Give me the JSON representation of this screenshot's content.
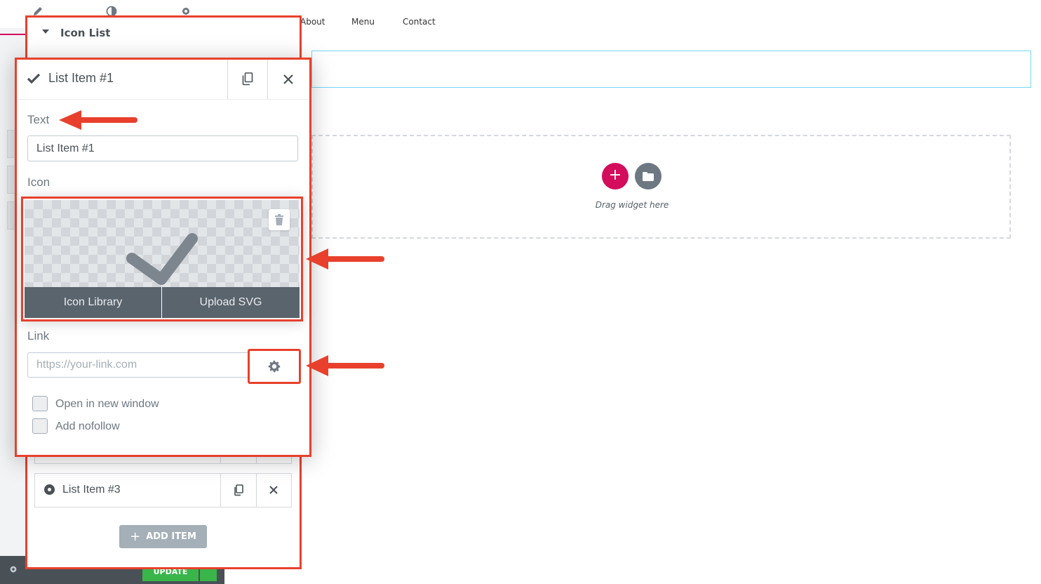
{
  "preview": {
    "nav": [
      "About",
      "Menu",
      "Contact"
    ],
    "drop_zone_text": "Drag widget here",
    "add_symbol": "+"
  },
  "sidebar": {
    "bottom": {
      "update_label": "UPDATE"
    }
  },
  "section": {
    "title": "Icon List",
    "items": [
      {
        "label": "List Item #1"
      },
      {
        "label": "List Item #3"
      }
    ],
    "add_item_label": "ADD ITEM",
    "add_item_symbol": "+"
  },
  "popup": {
    "title": "List Item #1",
    "text_label": "Text",
    "text_value": "List Item #1",
    "icon_label": "Icon",
    "icon_library_label": "Icon Library",
    "upload_svg_label": "Upload SVG",
    "link_label": "Link",
    "link_placeholder": "https://your-link.com",
    "open_new_window_label": "Open in new window",
    "add_nofollow_label": "Add nofollow"
  },
  "colors": {
    "highlight": "#e8402c",
    "accent": "#d30c5c",
    "update_green": "#39b54a",
    "panel_text": "#495157"
  }
}
